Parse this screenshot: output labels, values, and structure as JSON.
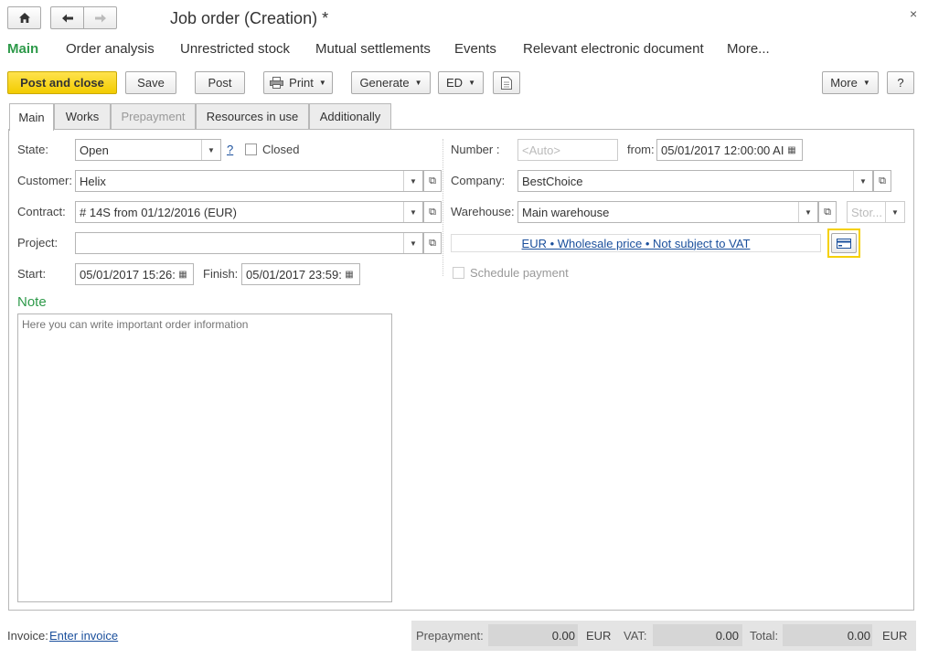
{
  "window": {
    "title": "Job order (Creation) *",
    "home_icon": "house-icon",
    "back_icon": "arrow-left-icon",
    "forward_icon": "arrow-right-icon",
    "close_icon": "close-icon",
    "close_glyph": "×"
  },
  "nav_tabs": [
    "Main",
    "Order analysis",
    "Unrestricted stock",
    "Mutual settlements",
    "Events",
    "Relevant electronic document",
    "More..."
  ],
  "toolbar": {
    "post_and_close": "Post and close",
    "save": "Save",
    "post": "Post",
    "print": "Print",
    "generate": "Generate",
    "ed": "ED",
    "more": "More",
    "help": "?"
  },
  "form_tabs": [
    "Main",
    "Works",
    "Prepayment",
    "Resources in use",
    "Additionally"
  ],
  "form": {
    "state_label": "State:",
    "state_value": "Open",
    "state_help": "?",
    "closed_label": "Closed",
    "customer_label": "Customer:",
    "customer_value": "Helix",
    "contract_label": "Contract:",
    "contract_value": "# 14S from 01/12/2016 (EUR)",
    "project_label": "Project:",
    "project_value": "",
    "start_label": "Start:",
    "start_value": "05/01/2017 15:26:",
    "finish_label": "Finish:",
    "finish_value": "05/01/2017 23:59:",
    "note_label": "Note",
    "note_placeholder": "Here you can write important order information",
    "number_label": "Number :",
    "number_placeholder": "<Auto>",
    "from_label": "from:",
    "from_value": "05/01/2017 12:00:00 AI",
    "company_label": "Company:",
    "company_value": "BestChoice",
    "warehouse_label": "Warehouse:",
    "warehouse_value": "Main warehouse",
    "storage_placeholder": "Stor...",
    "price_link": "EUR • Wholesale price • Not subject to VAT",
    "schedule_payment_label": "Schedule payment"
  },
  "footer": {
    "invoice_label": "Invoice:",
    "invoice_link": "Enter invoice",
    "prepayment_label": "Prepayment:",
    "prepayment_value": "0.00",
    "prepayment_currency": "EUR",
    "vat_label": "VAT:",
    "vat_value": "0.00",
    "total_label": "Total:",
    "total_value": "0.00",
    "total_currency": "EUR"
  },
  "colors": {
    "accent_green": "#2e9a4a",
    "primary_button": "#f5d000",
    "link_blue": "#1a4f9c"
  }
}
